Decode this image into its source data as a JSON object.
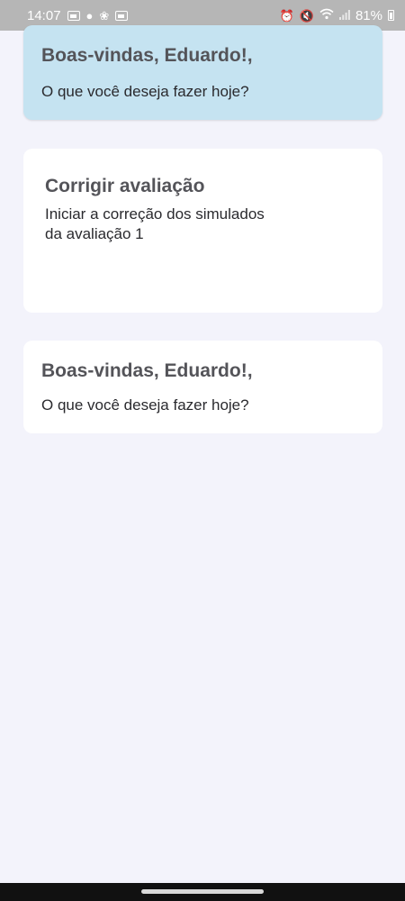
{
  "status_bar": {
    "time": "14:07",
    "battery": "81%",
    "left_icons": [
      "gallery-icon",
      "notification-icon",
      "fan-icon",
      "image-icon"
    ],
    "right_icons": [
      "alarm-icon",
      "mute-icon",
      "wifi-icon",
      "signal-icon",
      "battery-icon"
    ]
  },
  "welcome_card": {
    "title": "Boas-vindas, Eduardo!,",
    "subtitle": "O que você deseja fazer hoje?"
  },
  "action_card": {
    "title": "Corrigir avaliação",
    "description": "Iniciar a correção dos simulados da avaliação 1"
  },
  "welcome_card_2": {
    "title": "Boas-vindas, Eduardo!,",
    "subtitle": "O que você deseja fazer hoje?"
  },
  "colors": {
    "background": "#f3f3fb",
    "welcome_card_bg": "#c5e3f1",
    "card_bg": "#ffffff",
    "title_text": "#545459",
    "body_text": "#2a2a2e"
  }
}
